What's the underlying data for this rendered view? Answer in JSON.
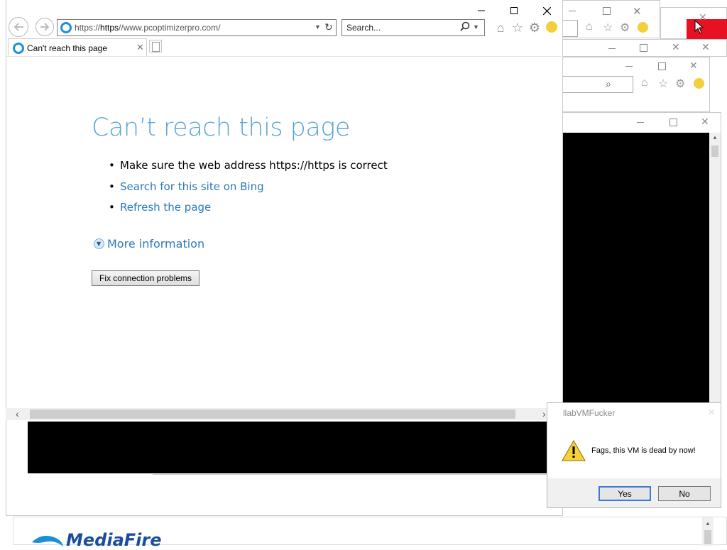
{
  "browser": {
    "address_prefix": "https://",
    "address_host": "https",
    "address_rest": "//www.pcoptimizerpro.com/",
    "search_placeholder": "Search...",
    "tab_title": "Can't reach this page"
  },
  "error_page": {
    "title": "Can’t reach this page",
    "bullet_1": "Make sure the web address https://https is correct",
    "bullet_2": "Search for this site on Bing",
    "bullet_3": "Refresh the page",
    "more_info": "More information",
    "fix_button": "Fix connection problems"
  },
  "dialog": {
    "title": "llabVMFucker",
    "message": "Fags, this VM is dead by now!",
    "yes_label": "Yes",
    "no_label": "No"
  },
  "background": {
    "brand": "MediaFire"
  },
  "colors": {
    "accent": "#5aa6d6",
    "link": "#2b7bbd",
    "close_hover": "#e81123"
  }
}
